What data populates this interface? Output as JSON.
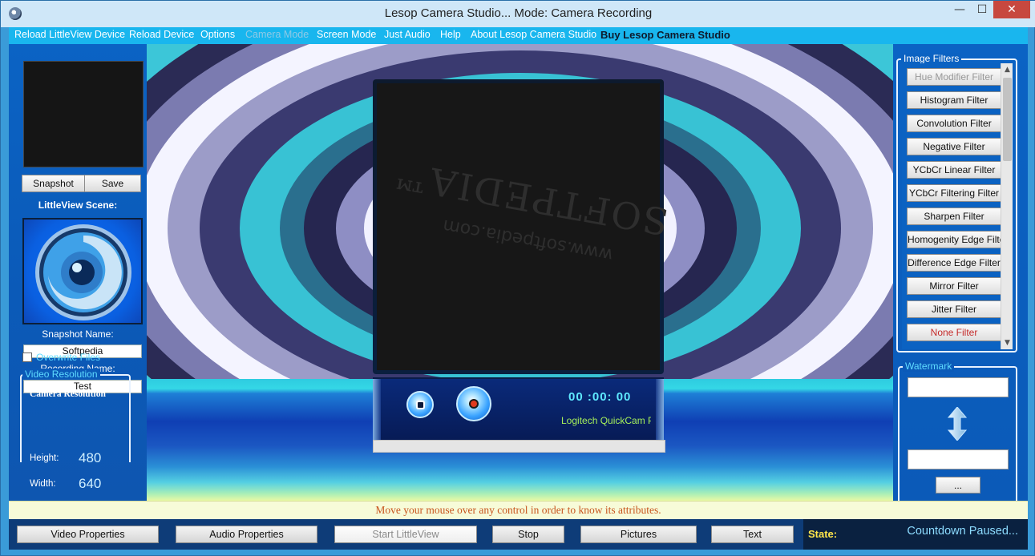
{
  "window": {
    "title": "Lesop Camera Studio... Mode: Camera Recording",
    "min_glyph": "—",
    "max_glyph": "☐",
    "close_glyph": "✕"
  },
  "menu": [
    {
      "label": "Reload LittleView Device",
      "enabled": true
    },
    {
      "label": "Reload Device",
      "enabled": true
    },
    {
      "label": "Options",
      "enabled": true
    },
    {
      "label": "Camera Mode",
      "enabled": false
    },
    {
      "label": "Screen Mode",
      "enabled": true
    },
    {
      "label": "Just Audio",
      "enabled": true
    },
    {
      "label": "Help",
      "enabled": true
    },
    {
      "label": "About Lesop Camera Studio",
      "enabled": true
    },
    {
      "label": "Buy Lesop Camera Studio",
      "enabled": true,
      "bold": true
    }
  ],
  "left": {
    "snapshot_button": "Snapshot",
    "save_button": "Save",
    "littleview_label": "LittleView Scene:",
    "snapshot_name_label": "Snapshot Name:",
    "snapshot_name_value": "Softpedia",
    "recording_name_label": "Recording Name:",
    "recording_name_value": "Test",
    "overwrite_label": "Overwrite Files",
    "overwrite_checked": false,
    "video_resolution_title": "Video Resolution",
    "camera_resolution_title": "Camera Resolution",
    "height_label": "Height:",
    "height_value": "480",
    "width_label": "Width:",
    "width_value": "640"
  },
  "stage": {
    "preview_watermark_main": "SOFTPEDIA™",
    "preview_watermark_url": "www.softpedia.com",
    "timer": "00 :00: 00",
    "device_name": "Logitech QuickCam Pro"
  },
  "filters": {
    "title": "Image Filters",
    "items": [
      {
        "label": "Hue Modifier Filter",
        "style": "dim"
      },
      {
        "label": "Histogram Filter",
        "style": "normal"
      },
      {
        "label": "Convolution Filter",
        "style": "normal"
      },
      {
        "label": "Negative Filter",
        "style": "normal"
      },
      {
        "label": "YCbCr Linear Filter",
        "style": "normal"
      },
      {
        "label": "YCbCr Filtering Filter",
        "style": "normal"
      },
      {
        "label": "Sharpen Filter",
        "style": "normal"
      },
      {
        "label": "Homogenity Edge Filter",
        "style": "normal"
      },
      {
        "label": "Difference Edge Filter",
        "style": "normal"
      },
      {
        "label": "Mirror Filter",
        "style": "normal"
      },
      {
        "label": "Jitter Filter",
        "style": "normal"
      },
      {
        "label": "None Filter",
        "style": "red"
      }
    ]
  },
  "watermark": {
    "title": "Watermark",
    "top_value": "",
    "bottom_value": "",
    "browse_label": "..."
  },
  "hint": "Move your mouse over any control in order to know its attributes.",
  "bottom": {
    "buttons": [
      {
        "label": "Video Properties",
        "enabled": true
      },
      {
        "label": "Audio Properties",
        "enabled": true
      },
      {
        "label": "Start LittleView",
        "enabled": false
      },
      {
        "label": "Stop",
        "enabled": true
      },
      {
        "label": "Pictures",
        "enabled": true
      },
      {
        "label": "Text",
        "enabled": true
      }
    ],
    "state_label": "State:",
    "state_value": "Countdown Paused..."
  },
  "colors": {
    "menubar": "#19b6ee",
    "panel": "#0b5ab8",
    "hint_text": "#c8551e",
    "state_label": "#ffe64a",
    "timer": "#5fe9ff",
    "device": "#a6ef5a"
  }
}
